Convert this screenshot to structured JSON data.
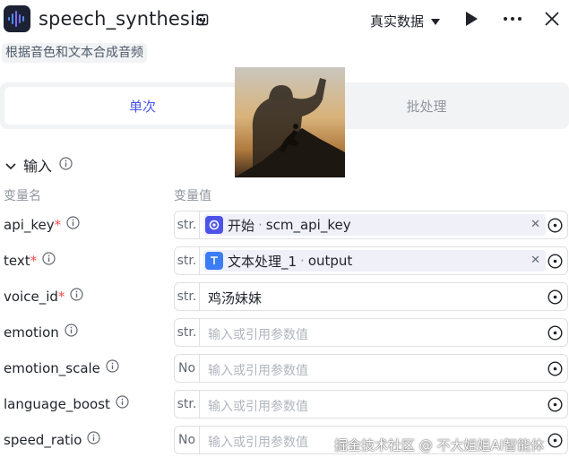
{
  "header": {
    "title": "speech_synthesis",
    "data_source": "真实数据",
    "description": "根据音色和文本合成音频"
  },
  "tabs": [
    {
      "label": "单次",
      "active": true
    },
    {
      "label": "批处理",
      "active": false
    }
  ],
  "input_section": {
    "title": "输入",
    "col_name": "变量名",
    "col_value": "变量值"
  },
  "params": [
    {
      "name": "api_key",
      "required": "*",
      "type": "str.",
      "source": "开始",
      "sep": "·",
      "ref": "scm_api_key"
    },
    {
      "name": "text",
      "required": "*",
      "type": "str.",
      "source": "文本处理_1",
      "sep": "·",
      "ref": "output"
    },
    {
      "name": "voice_id",
      "required": "*",
      "type": "str.",
      "value": "鸡汤妹妹"
    },
    {
      "name": "emotion",
      "type": "str.",
      "placeholder": "输入或引用参数值"
    },
    {
      "name": "emotion_scale",
      "type": "No",
      "placeholder": "输入或引用参数值"
    },
    {
      "name": "language_boost",
      "type": "str.",
      "placeholder": "输入或引用参数值"
    },
    {
      "name": "speed_ratio",
      "type": "No",
      "placeholder": "输入或引用参数值"
    }
  ],
  "watermark": "掘金技术社区 @ 不大姐姐AI智能体",
  "colors": {
    "accent": "#4d53e8",
    "required": "#f54a45",
    "border": "#dee0e3"
  }
}
